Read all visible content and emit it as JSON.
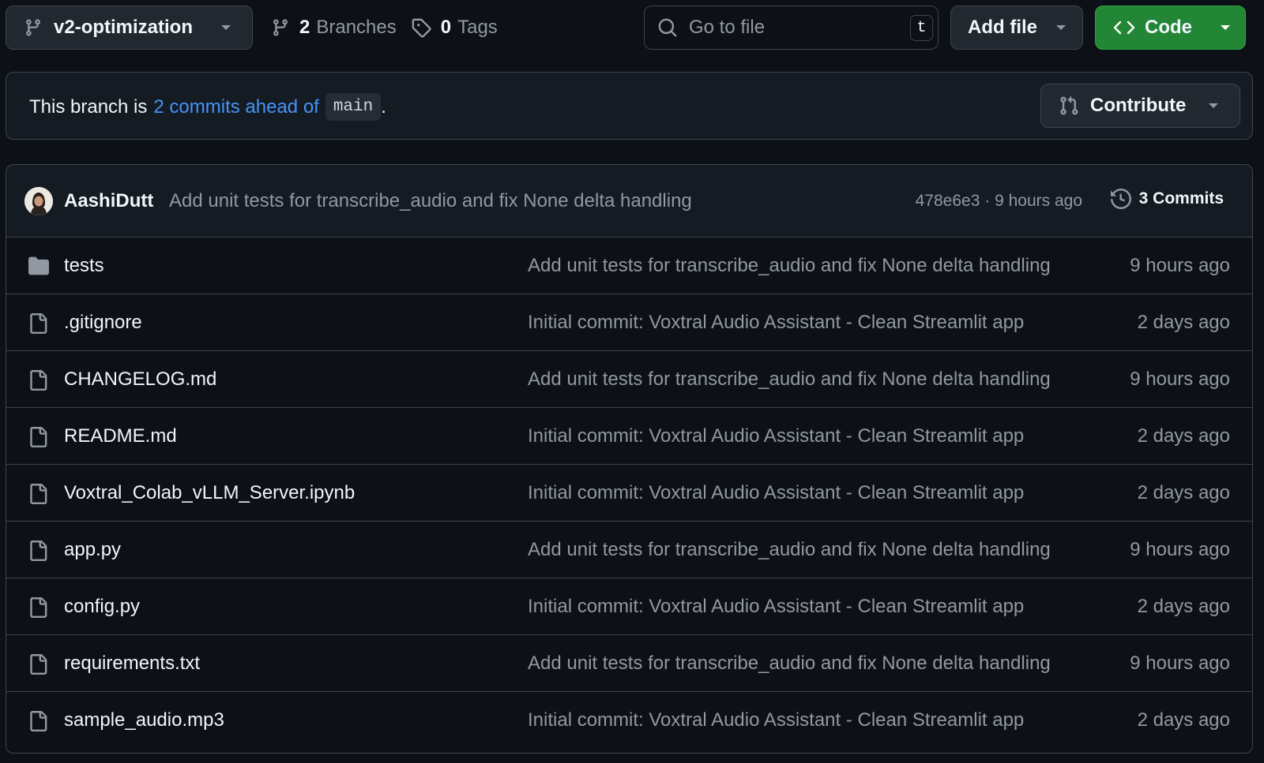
{
  "toolbar": {
    "branch": "v2-optimization",
    "branches_count": "2",
    "branches_label": "Branches",
    "tags_count": "0",
    "tags_label": "Tags",
    "search_placeholder": "Go to file",
    "search_shortcut": "t",
    "add_file_label": "Add file",
    "code_label": "Code"
  },
  "branch_info": {
    "prefix": "This branch is",
    "ahead_link": "2 commits ahead of",
    "base_branch": "main",
    "suffix": ".",
    "contribute_label": "Contribute"
  },
  "latest_commit": {
    "author": "AashiDutt",
    "message": "Add unit tests for transcribe_audio and fix None delta handling",
    "sha": "478e6e3",
    "separator": "·",
    "time": "9 hours ago",
    "commits_label": "3 Commits"
  },
  "files": [
    {
      "type": "folder",
      "name": "tests",
      "message": "Add unit tests for transcribe_audio and fix None delta handling",
      "time": "9 hours ago"
    },
    {
      "type": "file",
      "name": ".gitignore",
      "message": "Initial commit: Voxtral Audio Assistant - Clean Streamlit app",
      "time": "2 days ago"
    },
    {
      "type": "file",
      "name": "CHANGELOG.md",
      "message": "Add unit tests for transcribe_audio and fix None delta handling",
      "time": "9 hours ago"
    },
    {
      "type": "file",
      "name": "README.md",
      "message": "Initial commit: Voxtral Audio Assistant - Clean Streamlit app",
      "time": "2 days ago"
    },
    {
      "type": "file",
      "name": "Voxtral_Colab_vLLM_Server.ipynb",
      "message": "Initial commit: Voxtral Audio Assistant - Clean Streamlit app",
      "time": "2 days ago"
    },
    {
      "type": "file",
      "name": "app.py",
      "message": "Add unit tests for transcribe_audio and fix None delta handling",
      "time": "9 hours ago"
    },
    {
      "type": "file",
      "name": "config.py",
      "message": "Initial commit: Voxtral Audio Assistant - Clean Streamlit app",
      "time": "2 days ago"
    },
    {
      "type": "file",
      "name": "requirements.txt",
      "message": "Add unit tests for transcribe_audio and fix None delta handling",
      "time": "9 hours ago"
    },
    {
      "type": "file",
      "name": "sample_audio.mp3",
      "message": "Initial commit: Voxtral Audio Assistant - Clean Streamlit app",
      "time": "2 days ago"
    }
  ],
  "colors": {
    "background": "#0d1117",
    "link": "#4493f8",
    "code_button": "#238636",
    "muted_text": "#9198a1",
    "border": "#3d444d"
  }
}
